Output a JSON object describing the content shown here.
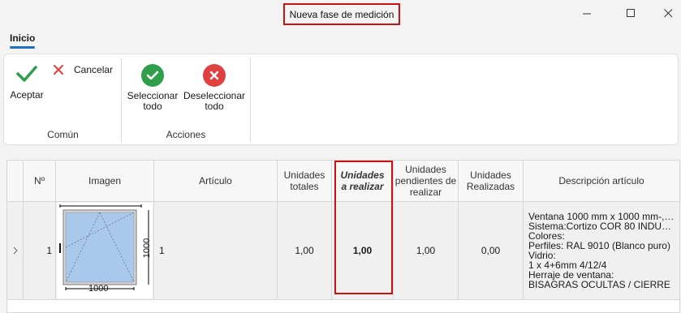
{
  "window": {
    "title": "Nueva fase de medición"
  },
  "ribbon": {
    "tab": "Inicio",
    "groups": [
      {
        "label": "Común",
        "buttons": [
          {
            "label": "Aceptar",
            "icon": "check-icon"
          },
          {
            "label": "Cancelar",
            "icon": "x-icon"
          }
        ]
      },
      {
        "label": "Acciones",
        "buttons": [
          {
            "label_line1": "Seleccionar",
            "label_line2": "todo",
            "icon": "check-circle-icon"
          },
          {
            "label_line1": "Deseleccionar",
            "label_line2": "todo",
            "icon": "x-circle-icon"
          }
        ]
      }
    ]
  },
  "grid": {
    "columns": {
      "num": "Nº",
      "imagen": "Imagen",
      "articulo": "Artículo",
      "unidades_totales_1": "Unidades",
      "unidades_totales_2": "totales",
      "unidades_realizar_1": "Unidades",
      "unidades_realizar_2": "a realizar",
      "pendientes_1": "Unidades",
      "pendientes_2": "pendientes de",
      "pendientes_3": "realizar",
      "realizadas_1": "Unidades",
      "realizadas_2": "Realizadas",
      "descripcion": "Descripción artículo"
    },
    "rows": [
      {
        "num": "1",
        "articulo": "1",
        "unidades_totales": "1,00",
        "unidades_realizar": "1,00",
        "pendientes": "1,00",
        "realizadas": "0,00",
        "image_width_label": "1000",
        "image_height_label": "1000",
        "descripcion": [
          "Ventana 1000 mm x 1000 mm-,…",
          "Sistema:Cortizo COR 80 INDU…",
          "Colores:",
          "Perfiles: RAL 9010 (Blanco puro)",
          "Vidrio:",
          "1 x 4+6mm 4/12/4",
          "Herraje de ventana:",
          "BISAGRAS OCULTAS / CIERRE"
        ]
      }
    ]
  },
  "colors": {
    "accent": "#1a6fc4",
    "highlight": "#cc1111",
    "green": "#2e9e4a",
    "red": "#e04040",
    "glass": "#a9c8ea"
  }
}
